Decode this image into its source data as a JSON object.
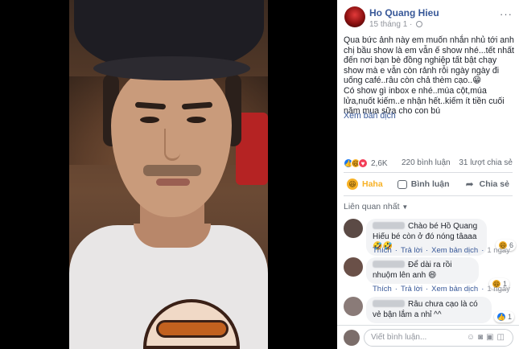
{
  "post": {
    "author": "Ho Quang Hieu",
    "time": "15 tháng 1 ·",
    "more": "···",
    "text": "Qua bức ảnh này em muốn nhắn nhủ tới anh chị bầu show là em vẫn ế show nhé...tết nhất đến nơi bạn bè đồng nghiệp tất bật chạy show mà e vẫn còn rảnh rỗi ngày ngày đi uống café..râu còn chả thèm cạo..😁\nCó show gì inbox e nhé..múa cột,múa lửa,nuốt kiếm..e nhận hết..kiếm ít tiền cuối năm mua sữa cho con bú",
    "see_translation": "Xem bản dịch",
    "reactions_count": "2,6K",
    "comments_count": "220 bình luận",
    "shares_count": "31 lượt chia sẻ"
  },
  "actions": {
    "haha": "Haha",
    "comment": "Bình luận",
    "share": "Chia sẻ"
  },
  "sort_label": "Liên quan nhất",
  "comments": [
    {
      "text": "Chào bé Hồ Quang Hiếu bé còn ở đó nóng tâaaa🤣🤣",
      "like": "Thích",
      "reply": "Trả lời",
      "translate": "Xem bản dịch",
      "time": "1 ngày",
      "react_count": "6"
    },
    {
      "text": "Để dài ra rồi nhuộm lên anh 😄",
      "like": "Thích",
      "reply": "Trả lời",
      "translate": "Xem bản dịch",
      "time": "1 ngày",
      "react_count": "1"
    },
    {
      "text": "Râu chưa cạo là có vẻ bận lắm a nhỉ ^^",
      "react_count": "1"
    }
  ],
  "write_placeholder": "Viết bình luận...",
  "colors": {
    "link": "#385898",
    "haha": "#f7b125",
    "like": "#1877f2",
    "love": "#f33e58"
  }
}
